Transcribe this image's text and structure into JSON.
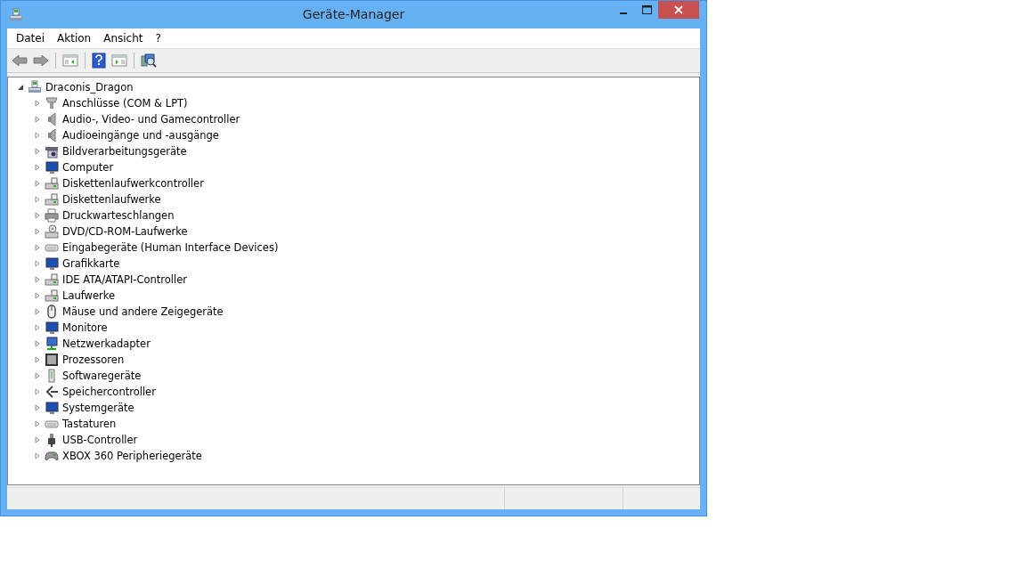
{
  "window": {
    "title": "Geräte-Manager"
  },
  "menu": [
    "Datei",
    "Aktion",
    "Ansicht",
    "?"
  ],
  "tree": {
    "label": "Draconis_Dragon",
    "expanded": true,
    "children": [
      {
        "label": "Anschlüsse (COM & LPT)",
        "expanded": false
      },
      {
        "label": "Audio-, Video- und Gamecontroller",
        "expanded": false
      },
      {
        "label": "Audioeingänge und -ausgänge",
        "expanded": false
      },
      {
        "label": "Bildverarbeitungsgeräte",
        "expanded": false
      },
      {
        "label": "Computer",
        "expanded": false
      },
      {
        "label": "Diskettenlaufwerkcontroller",
        "expanded": false
      },
      {
        "label": "Diskettenlaufwerke",
        "expanded": false
      },
      {
        "label": "Druckwarteschlangen",
        "expanded": false
      },
      {
        "label": "DVD/CD-ROM-Laufwerke",
        "expanded": false
      },
      {
        "label": "Eingabegeräte (Human Interface Devices)",
        "expanded": false
      },
      {
        "label": "Grafikkarte",
        "expanded": false
      },
      {
        "label": "IDE ATA/ATAPI-Controller",
        "expanded": false
      },
      {
        "label": "Laufwerke",
        "expanded": false
      },
      {
        "label": "Mäuse und andere Zeigegeräte",
        "expanded": false
      },
      {
        "label": "Monitore",
        "expanded": false
      },
      {
        "label": "Netzwerkadapter",
        "expanded": false
      },
      {
        "label": "Prozessoren",
        "expanded": false
      },
      {
        "label": "Softwaregeräte",
        "expanded": false
      },
      {
        "label": "Speichercontroller",
        "expanded": false
      },
      {
        "label": "Systemgeräte",
        "expanded": false
      },
      {
        "label": "Tastaturen",
        "expanded": false
      },
      {
        "label": "USB-Controller",
        "expanded": false
      },
      {
        "label": "XBOX 360 Peripheriegeräte",
        "expanded": false
      }
    ]
  }
}
